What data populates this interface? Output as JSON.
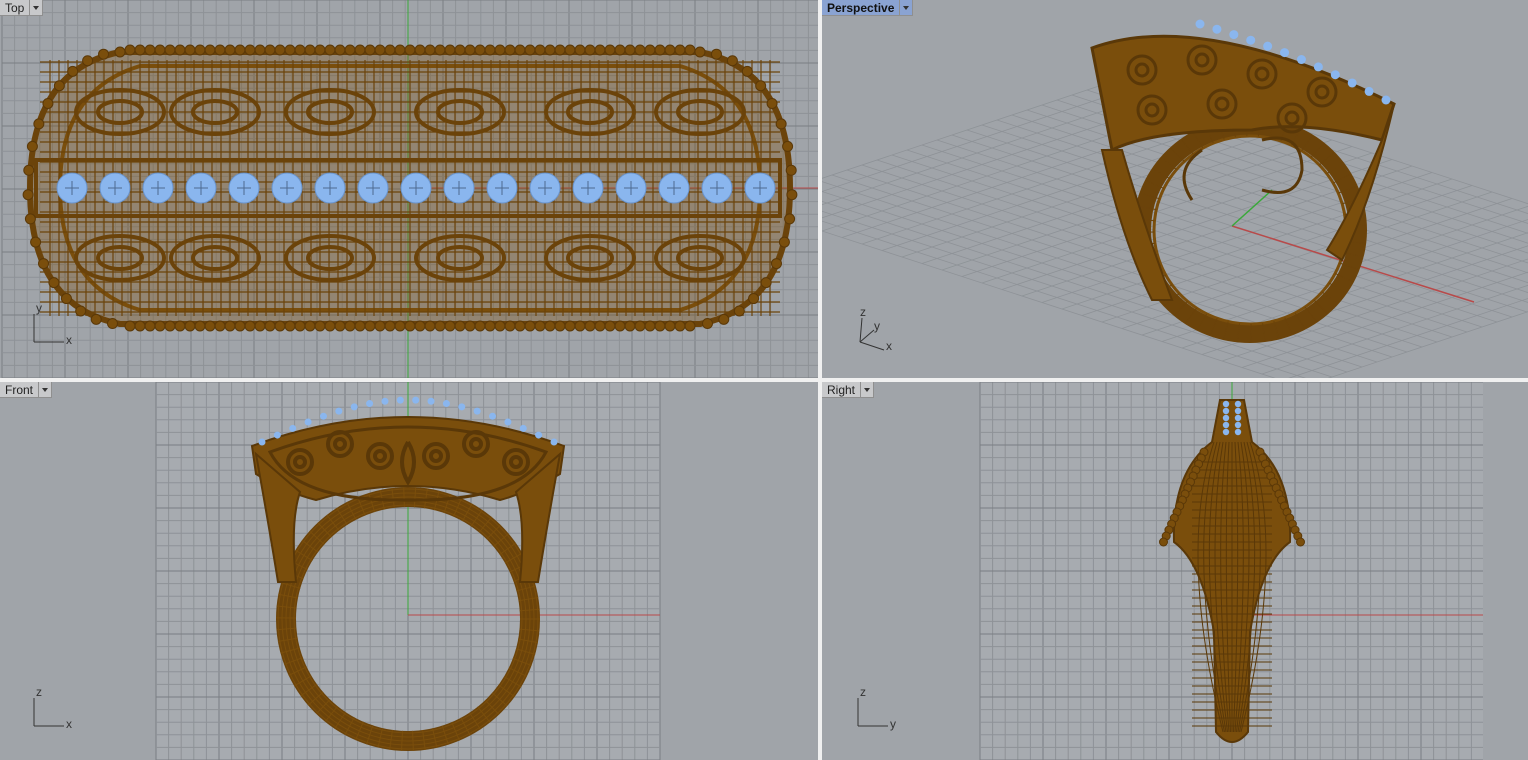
{
  "viewports": {
    "top": {
      "title": "Top",
      "axis_h": "x",
      "axis_v": "y",
      "active": false
    },
    "persp": {
      "title": "Perspective",
      "axis_h": "x",
      "axis_v": "z",
      "axis_d": "y",
      "active": true
    },
    "front": {
      "title": "Front",
      "axis_h": "x",
      "axis_v": "z",
      "active": false
    },
    "right": {
      "title": "Right",
      "axis_h": "y",
      "axis_v": "z",
      "active": false
    }
  },
  "colors": {
    "viewport_bg": "#a0a4a9",
    "grid_minor": "#8e9297",
    "grid_major": "#7a7e83",
    "x_axis": "#b84a4a",
    "y_axis": "#3aa83a",
    "wire": "#7a4e0c",
    "gem": "#8ab6ee",
    "active_tab": "#8aa3d2"
  },
  "icons": {
    "dropdown": "chevron-down-icon"
  }
}
